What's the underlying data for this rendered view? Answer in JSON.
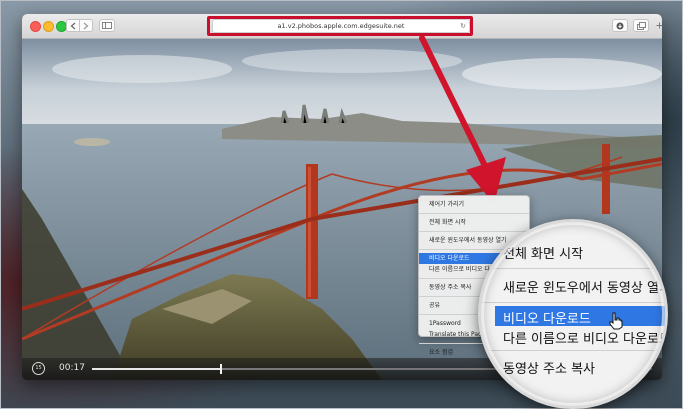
{
  "browser": {
    "address_url": "a1.v2.phobos.apple.com.edgesuite.net"
  },
  "video": {
    "current_time": "00:17",
    "progress": 0.23
  },
  "context_menu": {
    "items": [
      "제어기 가리기",
      "전체 화면 시작",
      "새로운 윈도우에서 동영상 열기",
      "비디오 다운로드",
      "다른 이름으로 비디오 다운로드",
      "동영상 주소 복사",
      "공유",
      "1Password",
      "Translate this Page",
      "요소 점검"
    ],
    "selected_item": "비디오 다운로드"
  },
  "magnified_menu": {
    "items": [
      "전체 화면 시작",
      "새로운 윈도우에서 동영상 열기",
      "비디오 다운로드",
      "다른 이름으로 비디오 다운로드",
      "동영상 주소 복사"
    ]
  },
  "colors": {
    "highlight": "#c8102e",
    "selection": "#2f78e4",
    "arrow": "#d0142c"
  }
}
